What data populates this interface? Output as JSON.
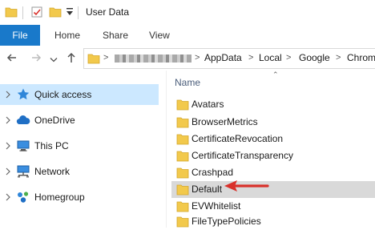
{
  "window": {
    "title": "User Data"
  },
  "ribbon": {
    "tabs": [
      "File",
      "Home",
      "Share",
      "View"
    ],
    "file_color": "#1979ca"
  },
  "address": {
    "crumbs": [
      "AppData",
      "Local",
      "Google",
      "Chrom"
    ]
  },
  "navigation_pane": {
    "items": [
      {
        "label": "Quick access",
        "icon": "star-icon",
        "selected": true
      },
      {
        "label": "OneDrive",
        "icon": "cloud-icon",
        "selected": false
      },
      {
        "label": "This PC",
        "icon": "computer-icon",
        "selected": false
      },
      {
        "label": "Network",
        "icon": "network-icon",
        "selected": false
      },
      {
        "label": "Homegroup",
        "icon": "homegroup-icon",
        "selected": false
      }
    ],
    "selected_color": "#cce8ff"
  },
  "content": {
    "column_header": "Name",
    "folders": [
      {
        "label": "Avatars",
        "highlighted": false
      },
      {
        "label": "BrowserMetrics",
        "highlighted": false
      },
      {
        "label": "CertificateRevocation",
        "highlighted": false
      },
      {
        "label": "CertificateTransparency",
        "highlighted": false
      },
      {
        "label": "Crashpad",
        "highlighted": false
      },
      {
        "label": "Default",
        "highlighted": true
      },
      {
        "label": "EVWhitelist",
        "highlighted": false
      },
      {
        "label": "FileTypePolicies",
        "highlighted": false
      }
    ],
    "highlight_color": "#d9d9d9",
    "annotation_arrow_color": "#d9312b"
  }
}
